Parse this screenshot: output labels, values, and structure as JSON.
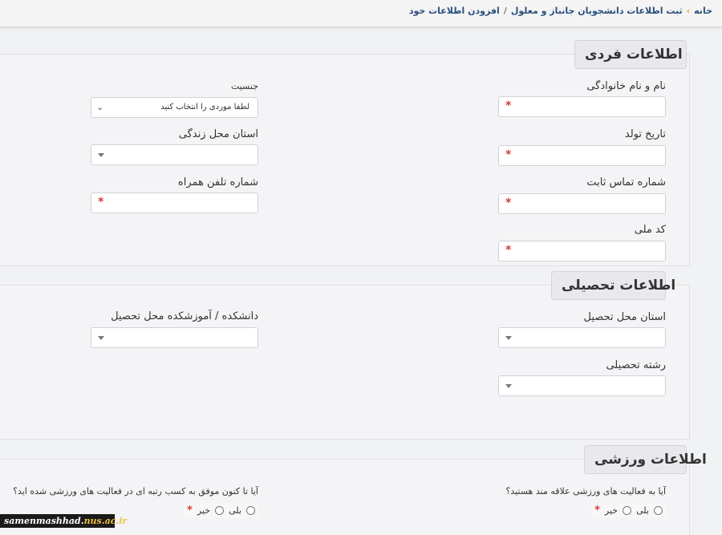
{
  "breadcrumb": {
    "home": "خانه",
    "section": "ثبت اطلاعات دانشجویان جانباز و معلول",
    "current": "افزودن اطلاعات خود"
  },
  "personal": {
    "legend": "اطلاعات فردی",
    "full_name_label": "نام و نام خانوادگی",
    "gender_label": "جنسیت",
    "gender_value": "لطفا موردی را انتخاب کنید",
    "birth_date_label": "تاریخ تولد",
    "province_label": "استان محل زندگی",
    "landline_label": "شماره تماس ثابت",
    "mobile_label": "شماره تلفن همراه",
    "national_code_label": "کد ملی",
    "required_mark": "*"
  },
  "education": {
    "legend": "اطلاعات تحصیلی",
    "province_label": "استان محل تحصیل",
    "faculty_label": "دانشکده / آموزشکده محل تحصیل",
    "major_label": "رشته تحصیلی"
  },
  "sports": {
    "legend": "اطلاعات ورزشی",
    "interest_question": "آیا به فعالیت های ورزشی علاقه مند هستید؟",
    "rank_question": "آیا تا کنون موفق به کسب رتبه ای در فعالیت های ورزشی شده اید؟",
    "yes_label": "بلی",
    "no_label": "خیر",
    "required_mark": "*"
  },
  "watermark": {
    "prefix": "samenmashhad.",
    "suffix": "nus.ac.ir"
  },
  "colors": {
    "required": "#d63a3a",
    "breadcrumb": "#2a4f7a",
    "breadcrumb_separator": "#f0a31c"
  },
  "icons": {
    "breadcrumb_separator": "chevron-right-icon",
    "select_caret": "caret-down-icon",
    "native_select": "chevron-down-icon"
  }
}
